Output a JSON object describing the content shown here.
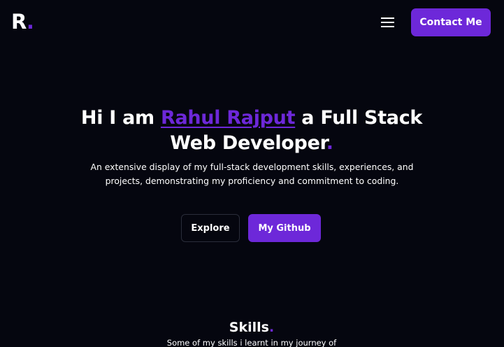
{
  "header": {
    "logo_letter": "R",
    "logo_dot": ".",
    "menu_icon": "hamburger-menu-icon",
    "contact_label": "Contact Me"
  },
  "hero": {
    "title_prefix": "Hi I am ",
    "title_name": "Rahul Rajput",
    "title_suffix": " a Full Stack Web Developer",
    "title_dot": ".",
    "description": "An extensive display of my full-stack development skills, experiences, and projects, demonstrating my proficiency and commitment to coding.",
    "explore_label": "Explore",
    "github_label": "My Github"
  },
  "skills": {
    "title": "Skills",
    "title_dot": ".",
    "description": "Some of my skills i learnt in my journey of"
  },
  "colors": {
    "background": "#05060f",
    "accent": "#6d28d9",
    "text": "#ffffff"
  }
}
